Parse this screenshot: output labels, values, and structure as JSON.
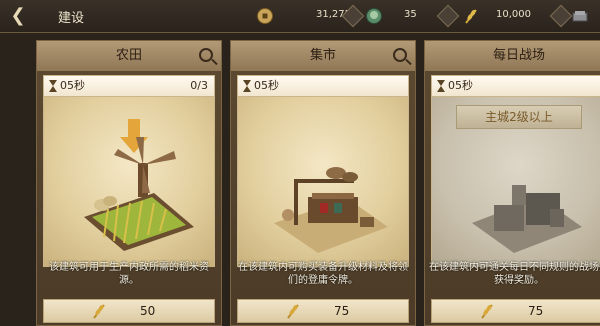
{
  "header": {
    "title": "建设",
    "resources": [
      {
        "icon": "coin-icon",
        "value": "31,275"
      },
      {
        "icon": "gem-icon",
        "value": "35"
      },
      {
        "icon": "grain-icon",
        "value": "10,000"
      },
      {
        "icon": "iron-icon",
        "value": ""
      }
    ]
  },
  "cards": [
    {
      "title": "农田",
      "timer": "05秒",
      "count": "0/3",
      "requirement": "",
      "description": "该建筑可用于生产内政所需的稻米资源。",
      "cost": "50"
    },
    {
      "title": "集市",
      "timer": "05秒",
      "count": "",
      "requirement": "",
      "description": "在该建筑内可购买装备升级材料及将领们的登庸令牌。",
      "cost": "75"
    },
    {
      "title": "每日战场",
      "timer": "05秒",
      "count": "",
      "requirement": "主城2级以上",
      "description": "在该建筑内可通关每日不同规则的战场并获得奖励。",
      "cost": "75"
    }
  ],
  "colors": {
    "accent": "#8f7654",
    "background": "#2a231b"
  }
}
